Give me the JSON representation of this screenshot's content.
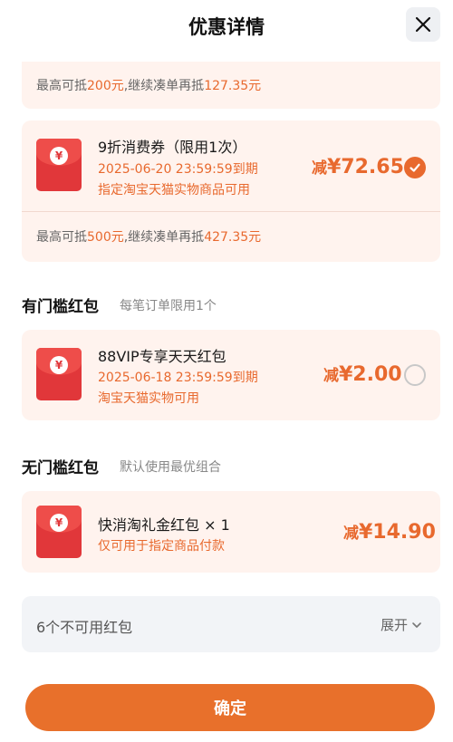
{
  "header": {
    "title": "优惠详情",
    "close_icon": "close-icon"
  },
  "top_tip": {
    "p1": "最高可抵",
    "v1": "200元",
    "p2": ",继续凑单再抵",
    "v2": "127.35元"
  },
  "coupon_main": {
    "title": "9折消费券（限用1次）",
    "expiry": "2025-06-20 23:59:59到期",
    "scope": "指定淘宝天猫实物商品可用",
    "amount_prefix": "减",
    "amount": "¥72.65",
    "selected": true,
    "tip": {
      "p1": "最高可抵",
      "v1": "500元",
      "p2": ",继续凑单再抵",
      "v2": "427.35元"
    }
  },
  "threshold_section": {
    "title": "有门槛红包",
    "note": "每笔订单限用1个"
  },
  "coupon_vip": {
    "title": "88VIP专享天天红包",
    "expiry": "2025-06-18 23:59:59到期",
    "scope": "淘宝天猫实物可用",
    "amount_prefix": "减",
    "amount": "¥2.00",
    "selected": false
  },
  "no_threshold_section": {
    "title": "无门槛红包",
    "note": "默认使用最优组合"
  },
  "coupon_kuai": {
    "title": "快消淘礼金红包 × 1",
    "scope": "仅可用于指定商品付款",
    "amount_prefix": "减",
    "amount": "¥14.90"
  },
  "unavailable": {
    "label": "6个不可用红包",
    "expand_label": "展开"
  },
  "confirm_button": {
    "label": "确定"
  },
  "colors": {
    "accent": "#e8692e",
    "card_bg": "#fff3ee",
    "envelope": "#e1373a",
    "button": "#e8702b"
  },
  "envelope_symbol": "¥"
}
